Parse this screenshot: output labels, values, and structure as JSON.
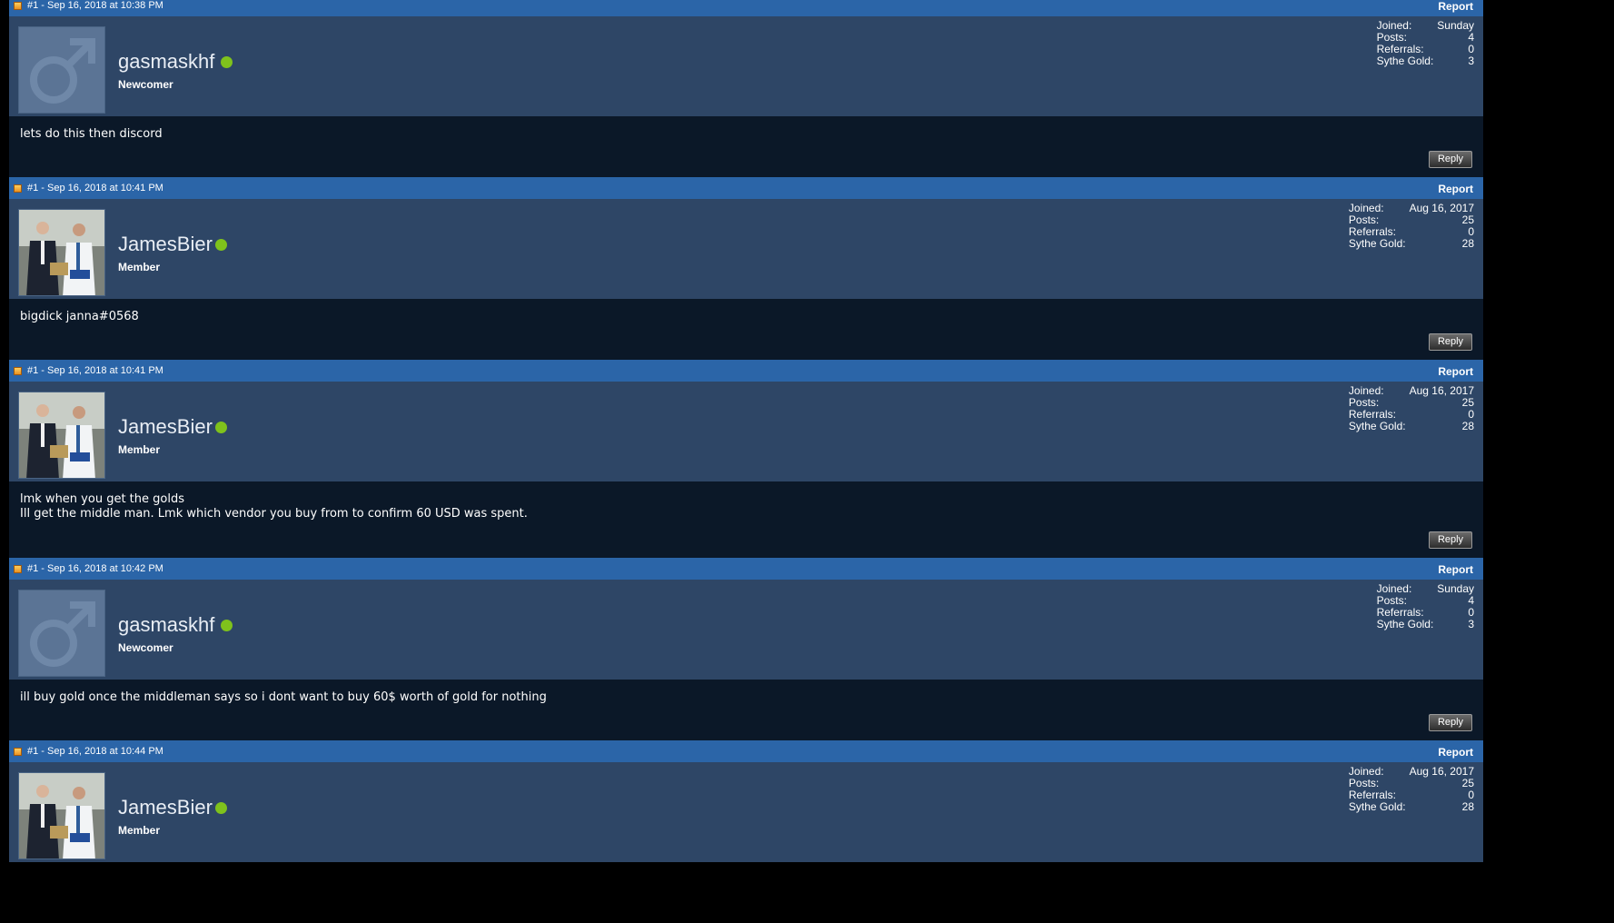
{
  "report_label": "Report",
  "reply_label": "Reply",
  "stat_labels": {
    "joined": "Joined:",
    "posts": "Posts:",
    "referrals": "Referrals:",
    "gold": "Sythe Gold:"
  },
  "colors": {
    "header": "#2b65a8",
    "profile": "#2e4666",
    "body": "#0b1828",
    "online": "#7fc21c"
  },
  "posts": [
    {
      "meta": "#1 - Sep 16, 2018 at 10:38 PM",
      "avatar": "default-male-avatar",
      "username": "gasmaskhf",
      "usertitle": "Newcomer",
      "stats": {
        "joined": "Sunday",
        "posts": "4",
        "referrals": "0",
        "gold": "3"
      },
      "body": [
        "lets do this then discord"
      ]
    },
    {
      "meta": "#1 - Sep 16, 2018 at 10:41 PM",
      "avatar": "photo-avatar",
      "username": "JamesBier",
      "usertitle": "Member",
      "stats": {
        "joined": "Aug 16, 2017",
        "posts": "25",
        "referrals": "0",
        "gold": "28"
      },
      "body": [
        "bigdick janna#0568"
      ]
    },
    {
      "meta": "#1 - Sep 16, 2018 at 10:41 PM",
      "avatar": "photo-avatar",
      "username": "JamesBier",
      "usertitle": "Member",
      "stats": {
        "joined": "Aug 16, 2017",
        "posts": "25",
        "referrals": "0",
        "gold": "28"
      },
      "body": [
        "lmk when you get the golds",
        "Ill get the middle man. Lmk which vendor you buy from to confirm 60 USD was spent."
      ]
    },
    {
      "meta": "#1 - Sep 16, 2018 at 10:42 PM",
      "avatar": "default-male-avatar",
      "username": "gasmaskhf",
      "usertitle": "Newcomer",
      "stats": {
        "joined": "Sunday",
        "posts": "4",
        "referrals": "0",
        "gold": "3"
      },
      "body": [
        "ill buy gold once the middleman says so i dont want to buy 60$ worth of gold for nothing"
      ]
    },
    {
      "meta": "#1 - Sep 16, 2018 at 10:44 PM",
      "avatar": "photo-avatar",
      "username": "JamesBier",
      "usertitle": "Member",
      "stats": {
        "joined": "Aug 16, 2017",
        "posts": "25",
        "referrals": "0",
        "gold": "28"
      },
      "body": []
    }
  ]
}
